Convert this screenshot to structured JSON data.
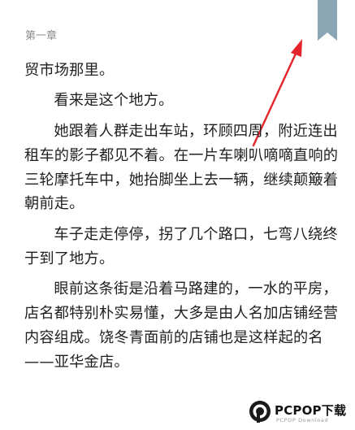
{
  "reader": {
    "chapter_header": "第一章",
    "paragraphs": [
      "贸市场那里。",
      "看来是这个地方。",
      "她跟着人群走出车站，环顾四周，附近连出租车的影子都见不着。在一片车喇叭嘀嘀直响的三轮摩托车中，她抬脚坐上去一辆，继续颠簸着朝前走。",
      "车子走走停停，拐了几个路口，七弯八绕终于到了地方。",
      "眼前这条街是沿着马路建的，一水的平房，店名都特别朴实易懂，大多是由人名加店铺经营内容组成。饶冬青面前的店铺也是这样起的名——亚华金店。"
    ]
  },
  "bookmark": {
    "icon": "bookmark-icon",
    "color": "#8aa5b3"
  },
  "annotation": {
    "arrow_color": "#e3242b"
  },
  "watermark": {
    "brand": "PCPOP下载",
    "subtitle": "PCPOP Download"
  }
}
